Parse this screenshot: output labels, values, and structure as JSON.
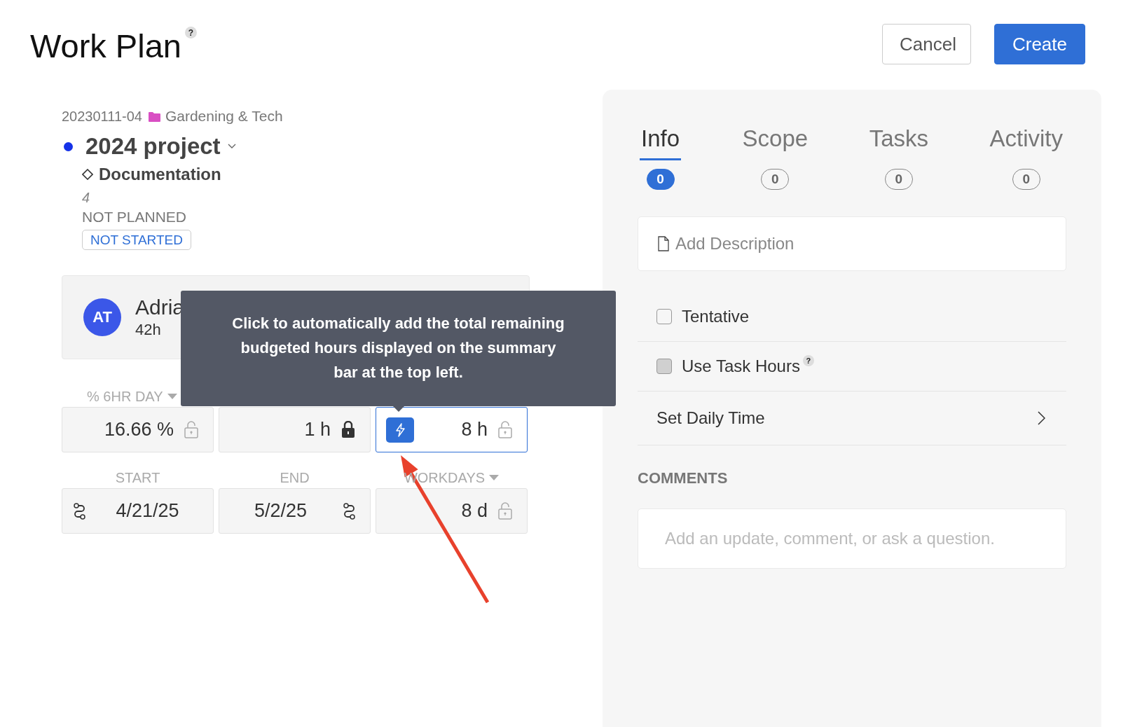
{
  "header": {
    "title": "Work Plan",
    "help": "?",
    "buttons": [
      {
        "label": "Cancel",
        "kind": "secondary"
      },
      {
        "label": "Create",
        "kind": "primary"
      }
    ]
  },
  "work": {
    "code": "20230111-04",
    "folder": "Gardening & Tech",
    "project": "2024 project",
    "phase": "Documentation",
    "number": "4",
    "plan_state": "NOT PLANNED",
    "status": "NOT STARTED"
  },
  "member": {
    "initials": "AT",
    "name": "Adria",
    "hours": "42h"
  },
  "tooltip": {
    "text": "Click to automatically add the total remaining budgeted hours displayed on the summary bar at the top left."
  },
  "rows": [
    {
      "labels": [
        {
          "text": "% 6HR DAY",
          "dropdown": true
        }
      ],
      "fields": [
        {
          "kind": "locked",
          "value": "16.66 %",
          "locked": false,
          "focused": false
        },
        {
          "kind": "locked",
          "value": "1 h",
          "locked": true,
          "focused": false
        },
        {
          "kind": "auto",
          "value": "8 h",
          "locked": false,
          "focused": true
        }
      ]
    },
    {
      "labels": [
        {
          "text": "START",
          "dropdown": false
        },
        {
          "text": "END",
          "dropdown": false
        },
        {
          "text": "WORKDAYS",
          "dropdown": true
        }
      ],
      "fields": [
        {
          "kind": "link-left",
          "value": "4/21/25"
        },
        {
          "kind": "link-right",
          "value": "5/2/25"
        },
        {
          "kind": "locked",
          "value": "8 d",
          "locked": false,
          "focused": false
        }
      ]
    }
  ],
  "tabs": [
    {
      "label": "Info",
      "count": "0",
      "selected": true
    },
    {
      "label": "Scope",
      "count": "0",
      "selected": false
    },
    {
      "label": "Tasks",
      "count": "0",
      "selected": false
    },
    {
      "label": "Activity",
      "count": "0",
      "selected": false
    }
  ],
  "description": {
    "placeholder": "Add Description"
  },
  "options": [
    {
      "kind": "checkbox",
      "label": "Tentative",
      "checked": false,
      "disabled": false,
      "help": false
    },
    {
      "kind": "checkbox",
      "label": "Use Task Hours",
      "checked": false,
      "disabled": true,
      "help": true
    },
    {
      "kind": "link",
      "label": "Set Daily Time"
    }
  ],
  "comments": {
    "heading": "COMMENTS",
    "placeholder": "Add an update, comment, or ask a question."
  }
}
